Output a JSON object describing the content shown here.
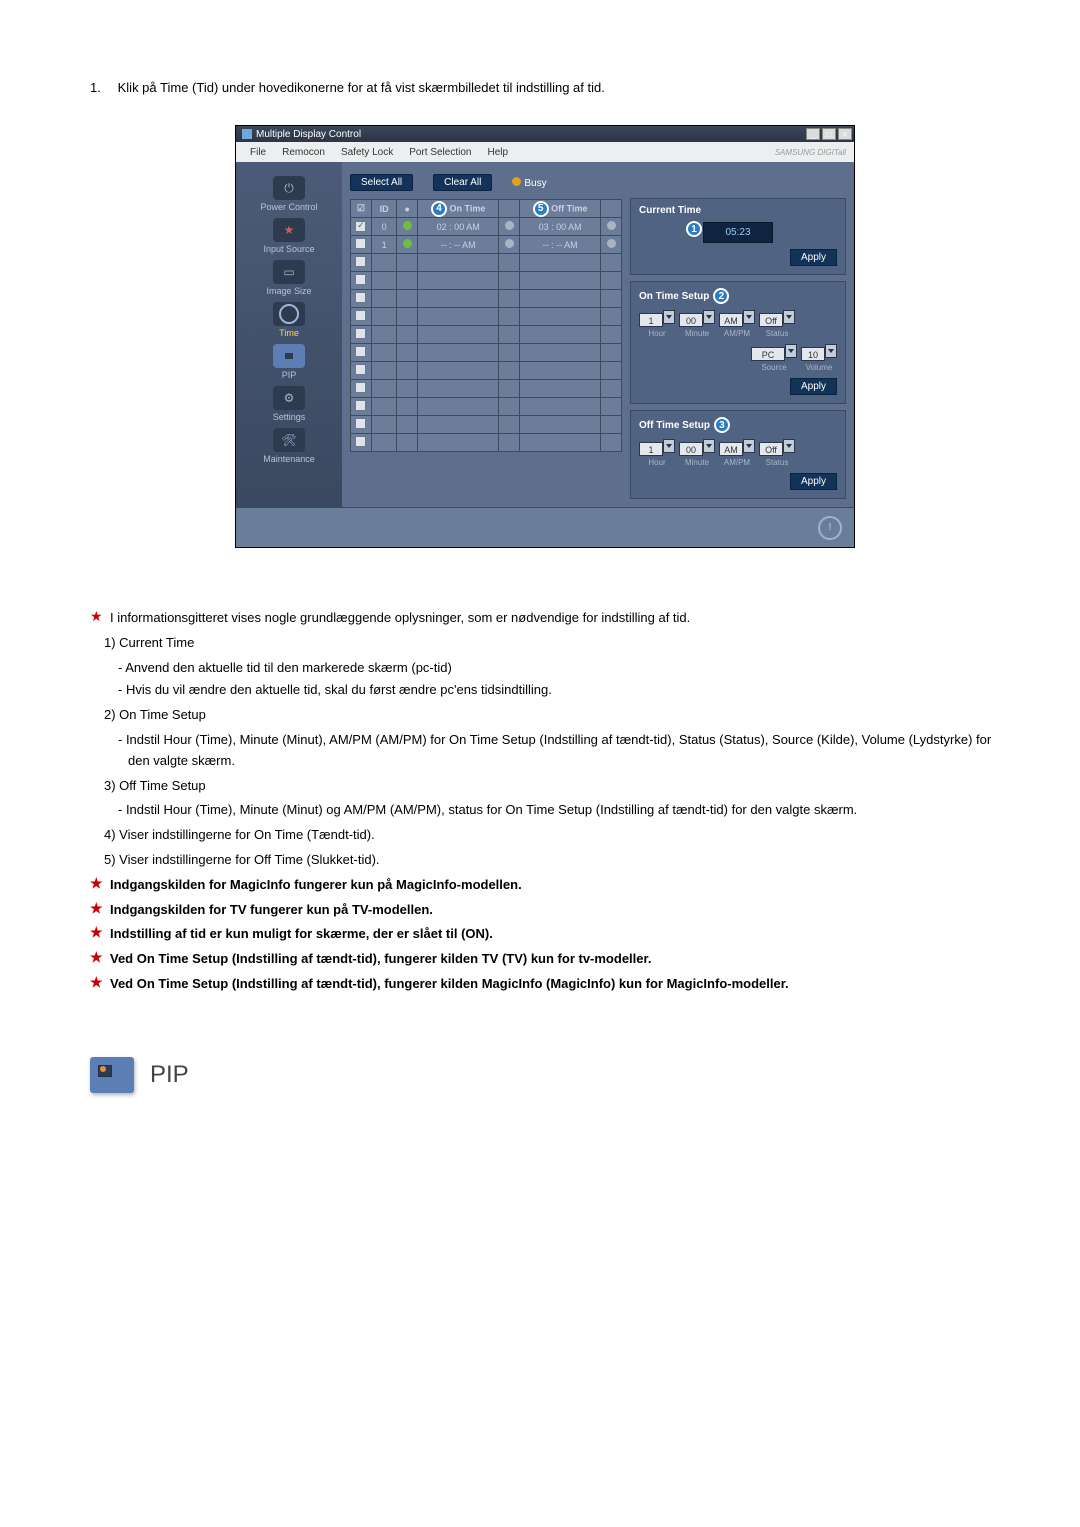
{
  "intro": {
    "num": "1.",
    "text": "Klik på Time (Tid) under hovedikonerne for at få vist skærmbilledet til indstilling af tid."
  },
  "window": {
    "title": "Multiple Display Control",
    "menu": [
      "File",
      "Remocon",
      "Safety Lock",
      "Port Selection",
      "Help"
    ],
    "brand": "SAMSUNG DIGITall"
  },
  "sidebar": [
    {
      "label": "Power Control"
    },
    {
      "label": "Input Source"
    },
    {
      "label": "Image Size"
    },
    {
      "label": "Time",
      "active": true
    },
    {
      "label": "PIP"
    },
    {
      "label": "Settings"
    },
    {
      "label": "Maintenance"
    }
  ],
  "buttons": {
    "select_all": "Select All",
    "clear_all": "Clear All",
    "busy": "Busy",
    "apply": "Apply"
  },
  "grid": {
    "headers": {
      "chk": "☑",
      "id": "ID",
      "state": "",
      "on_time": "On Time",
      "s1": "",
      "off_time": "Off Time",
      "s2": ""
    },
    "rows": [
      {
        "chk": true,
        "id": "0",
        "state": "green",
        "on_time": "02 : 00  AM",
        "s1": "gray",
        "off_time": "03 : 00  AM",
        "s2": "gray"
      },
      {
        "chk": false,
        "id": "1",
        "state": "green",
        "on_time": "-- : --  AM",
        "s1": "gray",
        "off_time": "-- : --  AM",
        "s2": "gray"
      }
    ],
    "empty_rows": 11
  },
  "markers": {
    "m1": "1",
    "m2": "2",
    "m3": "3",
    "m4": "4",
    "m5": "5"
  },
  "current_time": {
    "title": "Current Time",
    "value": "05:23"
  },
  "on_time_setup": {
    "title": "On Time Setup",
    "hour": "1",
    "minute": "00",
    "ampm": "AM",
    "status": "Off",
    "source": "PC",
    "volume": "10",
    "labels": {
      "hour": "Hour",
      "minute": "Minute",
      "ampm": "AM/PM",
      "status": "Status",
      "source": "Source",
      "volume": "Volume"
    }
  },
  "off_time_setup": {
    "title": "Off Time Setup",
    "hour": "1",
    "minute": "00",
    "ampm": "AM",
    "status": "Off",
    "labels": {
      "hour": "Hour",
      "minute": "Minute",
      "ampm": "AM/PM",
      "status": "Status"
    }
  },
  "notes": {
    "star1": "I informationsgitteret vises nogle grundlæggende oplysninger, som er nødvendige for indstilling af tid.",
    "n1": "1)  Current Time",
    "n1a": "- Anvend den aktuelle tid til den markerede skærm (pc-tid)",
    "n1b": "- Hvis du vil ændre den aktuelle tid, skal du først ændre pc'ens tidsindtilling.",
    "n2": "2)  On Time Setup",
    "n2a": "- Indstil Hour (Time), Minute (Minut), AM/PM (AM/PM) for On Time Setup (Indstilling af tændt-tid), Status (Status), Source (Kilde), Volume (Lydstyrke) for den valgte skærm.",
    "n3": "3)  Off Time Setup",
    "n3a": "- Indstil Hour (Time), Minute (Minut) og AM/PM (AM/PM), status for On Time Setup (Indstilling af tændt-tid) for den valgte skærm.",
    "n4": "4)  Viser indstillingerne for On Time (Tændt-tid).",
    "n5": "5)  Viser indstillingerne for Off Time (Slukket-tid).",
    "star2": "Indgangskilden for MagicInfo fungerer kun på MagicInfo-modellen.",
    "star3": "Indgangskilden for TV fungerer kun på TV-modellen.",
    "star4": "Indstilling af tid er kun muligt for skærme, der er slået til (ON).",
    "star5": "Ved On Time Setup (Indstilling af tændt-tid), fungerer kilden TV (TV) kun for tv-modeller.",
    "star6": "Ved On Time Setup (Indstilling af tændt-tid), fungerer kilden MagicInfo (MagicInfo) kun for MagicInfo-modeller."
  },
  "pip_heading": "PIP"
}
